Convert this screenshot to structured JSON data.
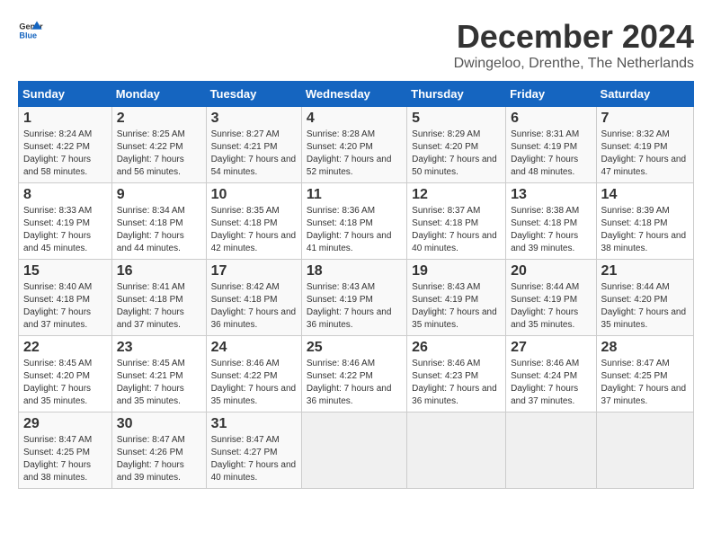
{
  "header": {
    "logo_general": "General",
    "logo_blue": "Blue",
    "title": "December 2024",
    "subtitle": "Dwingeloo, Drenthe, The Netherlands"
  },
  "calendar": {
    "days_of_week": [
      "Sunday",
      "Monday",
      "Tuesday",
      "Wednesday",
      "Thursday",
      "Friday",
      "Saturday"
    ],
    "weeks": [
      [
        null,
        null,
        null,
        null,
        null,
        null,
        null
      ]
    ]
  },
  "days": {
    "d1": {
      "num": "1",
      "sunrise": "8:24 AM",
      "sunset": "4:22 PM",
      "daylight": "7 hours and 58 minutes."
    },
    "d2": {
      "num": "2",
      "sunrise": "8:25 AM",
      "sunset": "4:22 PM",
      "daylight": "7 hours and 56 minutes."
    },
    "d3": {
      "num": "3",
      "sunrise": "8:27 AM",
      "sunset": "4:21 PM",
      "daylight": "7 hours and 54 minutes."
    },
    "d4": {
      "num": "4",
      "sunrise": "8:28 AM",
      "sunset": "4:20 PM",
      "daylight": "7 hours and 52 minutes."
    },
    "d5": {
      "num": "5",
      "sunrise": "8:29 AM",
      "sunset": "4:20 PM",
      "daylight": "7 hours and 50 minutes."
    },
    "d6": {
      "num": "6",
      "sunrise": "8:31 AM",
      "sunset": "4:19 PM",
      "daylight": "7 hours and 48 minutes."
    },
    "d7": {
      "num": "7",
      "sunrise": "8:32 AM",
      "sunset": "4:19 PM",
      "daylight": "7 hours and 47 minutes."
    },
    "d8": {
      "num": "8",
      "sunrise": "8:33 AM",
      "sunset": "4:19 PM",
      "daylight": "7 hours and 45 minutes."
    },
    "d9": {
      "num": "9",
      "sunrise": "8:34 AM",
      "sunset": "4:18 PM",
      "daylight": "7 hours and 44 minutes."
    },
    "d10": {
      "num": "10",
      "sunrise": "8:35 AM",
      "sunset": "4:18 PM",
      "daylight": "7 hours and 42 minutes."
    },
    "d11": {
      "num": "11",
      "sunrise": "8:36 AM",
      "sunset": "4:18 PM",
      "daylight": "7 hours and 41 minutes."
    },
    "d12": {
      "num": "12",
      "sunrise": "8:37 AM",
      "sunset": "4:18 PM",
      "daylight": "7 hours and 40 minutes."
    },
    "d13": {
      "num": "13",
      "sunrise": "8:38 AM",
      "sunset": "4:18 PM",
      "daylight": "7 hours and 39 minutes."
    },
    "d14": {
      "num": "14",
      "sunrise": "8:39 AM",
      "sunset": "4:18 PM",
      "daylight": "7 hours and 38 minutes."
    },
    "d15": {
      "num": "15",
      "sunrise": "8:40 AM",
      "sunset": "4:18 PM",
      "daylight": "7 hours and 37 minutes."
    },
    "d16": {
      "num": "16",
      "sunrise": "8:41 AM",
      "sunset": "4:18 PM",
      "daylight": "7 hours and 37 minutes."
    },
    "d17": {
      "num": "17",
      "sunrise": "8:42 AM",
      "sunset": "4:18 PM",
      "daylight": "7 hours and 36 minutes."
    },
    "d18": {
      "num": "18",
      "sunrise": "8:43 AM",
      "sunset": "4:19 PM",
      "daylight": "7 hours and 36 minutes."
    },
    "d19": {
      "num": "19",
      "sunrise": "8:43 AM",
      "sunset": "4:19 PM",
      "daylight": "7 hours and 35 minutes."
    },
    "d20": {
      "num": "20",
      "sunrise": "8:44 AM",
      "sunset": "4:19 PM",
      "daylight": "7 hours and 35 minutes."
    },
    "d21": {
      "num": "21",
      "sunrise": "8:44 AM",
      "sunset": "4:20 PM",
      "daylight": "7 hours and 35 minutes."
    },
    "d22": {
      "num": "22",
      "sunrise": "8:45 AM",
      "sunset": "4:20 PM",
      "daylight": "7 hours and 35 minutes."
    },
    "d23": {
      "num": "23",
      "sunrise": "8:45 AM",
      "sunset": "4:21 PM",
      "daylight": "7 hours and 35 minutes."
    },
    "d24": {
      "num": "24",
      "sunrise": "8:46 AM",
      "sunset": "4:22 PM",
      "daylight": "7 hours and 35 minutes."
    },
    "d25": {
      "num": "25",
      "sunrise": "8:46 AM",
      "sunset": "4:22 PM",
      "daylight": "7 hours and 36 minutes."
    },
    "d26": {
      "num": "26",
      "sunrise": "8:46 AM",
      "sunset": "4:23 PM",
      "daylight": "7 hours and 36 minutes."
    },
    "d27": {
      "num": "27",
      "sunrise": "8:46 AM",
      "sunset": "4:24 PM",
      "daylight": "7 hours and 37 minutes."
    },
    "d28": {
      "num": "28",
      "sunrise": "8:47 AM",
      "sunset": "4:25 PM",
      "daylight": "7 hours and 37 minutes."
    },
    "d29": {
      "num": "29",
      "sunrise": "8:47 AM",
      "sunset": "4:25 PM",
      "daylight": "7 hours and 38 minutes."
    },
    "d30": {
      "num": "30",
      "sunrise": "8:47 AM",
      "sunset": "4:26 PM",
      "daylight": "7 hours and 39 minutes."
    },
    "d31": {
      "num": "31",
      "sunrise": "8:47 AM",
      "sunset": "4:27 PM",
      "daylight": "7 hours and 40 minutes."
    }
  },
  "labels": {
    "sunrise": "Sunrise:",
    "sunset": "Sunset:",
    "daylight": "Daylight:"
  }
}
